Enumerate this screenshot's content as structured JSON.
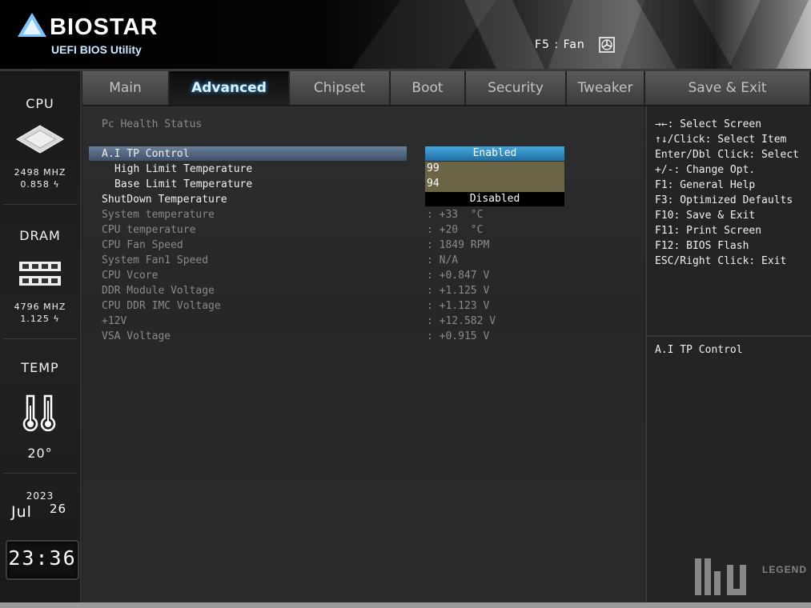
{
  "header": {
    "brand": "BIOSTAR",
    "utility": "UEFI BIOS Utility",
    "fan_hint": "F5 : Fan"
  },
  "sidebar": {
    "cpu": {
      "title": "CPU",
      "freq": "2498 MHZ",
      "volt": "0.858 ϟ"
    },
    "dram": {
      "title": "DRAM",
      "freq": "4796 MHZ",
      "volt": "1.125 ϟ"
    },
    "temp": {
      "title": "TEMP",
      "value": "20°"
    },
    "date": {
      "year": "2023",
      "month": "Jul",
      "day": "26"
    },
    "clock": "23:36"
  },
  "tabs": [
    {
      "label": "Main"
    },
    {
      "label": "Advanced"
    },
    {
      "label": "Chipset"
    },
    {
      "label": "Boot"
    },
    {
      "label": "Security"
    },
    {
      "label": "Tweaker"
    },
    {
      "label": "Save & Exit"
    }
  ],
  "active_tab": "Advanced",
  "main": {
    "section_title": "Pc Health Status",
    "settings": [
      {
        "label": "A.I TP Control",
        "value": "Enabled"
      },
      {
        "label": "High Limit Temperature",
        "value": "99"
      },
      {
        "label": "Base Limit Temperature",
        "value": "94"
      },
      {
        "label": "ShutDown Temperature",
        "value": "Disabled"
      }
    ],
    "readings": [
      {
        "label": "System temperature",
        "value": ": +33  °C"
      },
      {
        "label": "CPU temperature",
        "value": ": +20  °C"
      },
      {
        "label": "CPU Fan Speed",
        "value": ": 1849 RPM"
      },
      {
        "label": "System Fan1 Speed",
        "value": ": N/A"
      },
      {
        "label": "CPU Vcore",
        "value": ": +0.847 V"
      },
      {
        "label": "DDR Module Voltage",
        "value": ": +1.125 V"
      },
      {
        "label": "CPU DDR IMC Voltage",
        "value": ": +1.123 V"
      },
      {
        "label": "+12V",
        "value": ": +12.582 V"
      },
      {
        "label": "VSA Voltage",
        "value": ": +0.915 V"
      }
    ]
  },
  "help": {
    "keys": [
      "→←: Select Screen",
      "↑↓/Click: Select Item",
      "Enter/Dbl Click: Select",
      "+/-: Change Opt.",
      "F1: General Help",
      "F3: Optimized Defaults",
      "F10: Save & Exit",
      "F11: Print Screen",
      "F12: BIOS Flash",
      "ESC/Right Click: Exit"
    ],
    "description": "A.I TP Control"
  },
  "watermark": {
    "word": "LEGEND"
  },
  "colors": {
    "selected_value": "#2b8ec4",
    "number_field": "#6b6446",
    "highlight_row": "#4d6380",
    "active_tab_glow": "#2ea3ff"
  }
}
